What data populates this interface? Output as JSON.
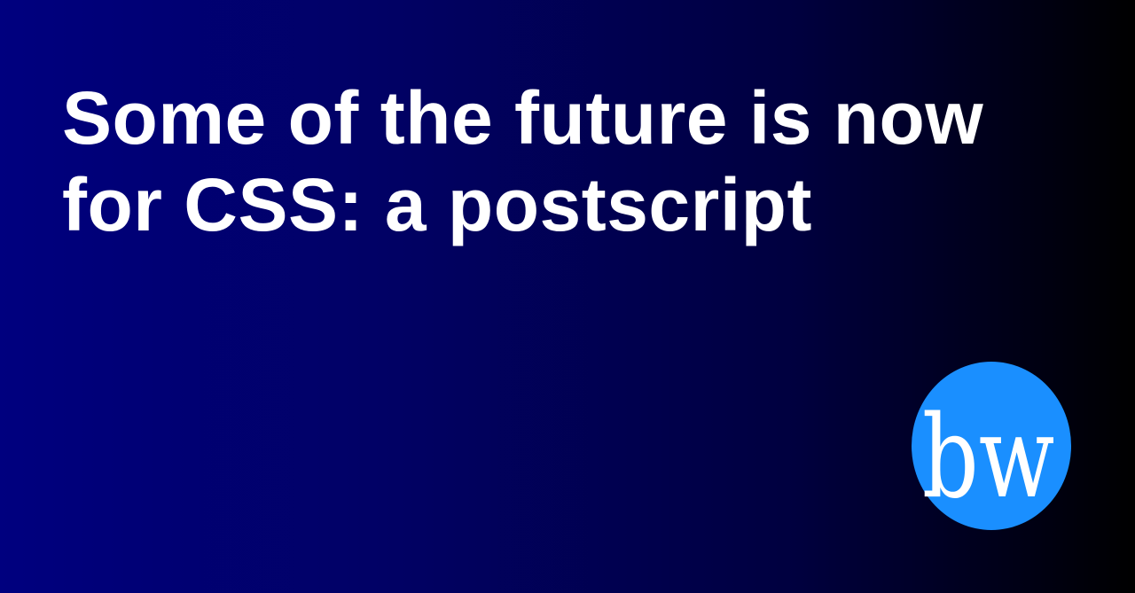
{
  "title": "Some of the future is now for CSS: a postscript",
  "logo": {
    "text": "bw",
    "circle_color": "#1a8fff",
    "text_color": "#ffffff"
  },
  "background": {
    "gradient_start": "#00007f",
    "gradient_end": "#000000"
  }
}
